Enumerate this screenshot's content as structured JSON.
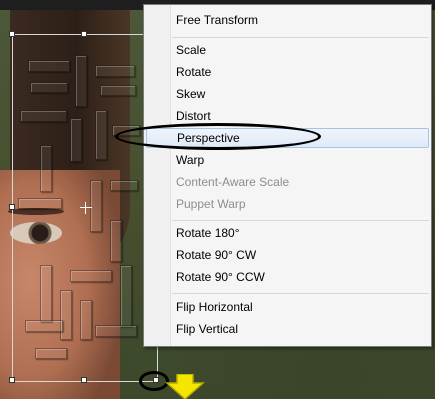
{
  "menu": {
    "items": [
      {
        "label": "Free Transform",
        "enabled": true
      },
      {
        "label": "Scale",
        "enabled": true
      },
      {
        "label": "Rotate",
        "enabled": true
      },
      {
        "label": "Skew",
        "enabled": true
      },
      {
        "label": "Distort",
        "enabled": true
      },
      {
        "label": "Perspective",
        "enabled": true,
        "highlighted": true
      },
      {
        "label": "Warp",
        "enabled": true
      },
      {
        "label": "Content-Aware Scale",
        "enabled": false
      },
      {
        "label": "Puppet Warp",
        "enabled": false
      },
      {
        "label": "Rotate 180°",
        "enabled": true
      },
      {
        "label": "Rotate 90° CW",
        "enabled": true
      },
      {
        "label": "Rotate 90° CCW",
        "enabled": true
      },
      {
        "label": "Flip Horizontal",
        "enabled": true
      },
      {
        "label": "Flip Vertical",
        "enabled": true
      }
    ]
  },
  "annotations": {
    "ellipse_color": "#000000",
    "arrow_color": "#f5e600",
    "arrow_icon": "arrow-down-icon"
  },
  "icons": {
    "center": "crosshair-icon"
  }
}
